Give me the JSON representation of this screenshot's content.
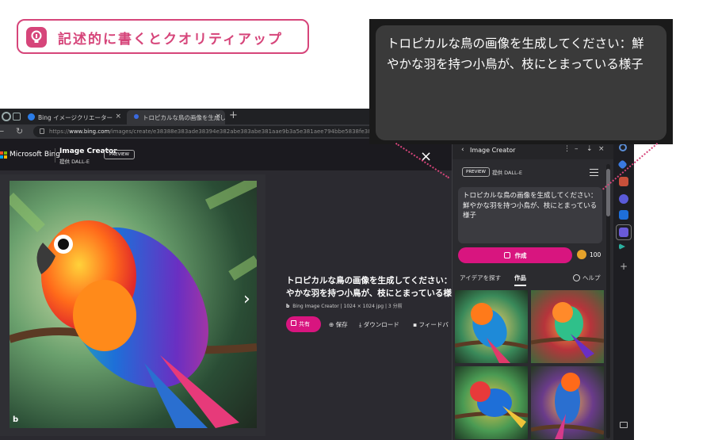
{
  "tip": {
    "text": "記述的に書くとクオリティアップ",
    "color": "#d6457a"
  },
  "callout": {
    "text": "トロピカルな鳥の画像を生成してください：鮮やかな羽を持つ小鳥が、枝にとまっている様子"
  },
  "browser": {
    "tabs": [
      {
        "label": "Bing イメージクリエーター",
        "close": "×"
      },
      {
        "label": "トロピカルな鳥の画像を生成してくださ",
        "close": "×"
      }
    ],
    "new_tab": "+",
    "url_prefix": "https://",
    "url_host": "www.bing.com",
    "url_path": "/images/create/e38388e383ade38394e382abe383abe381aae9b3a5e381aee794bbe5838fe38292e794"
  },
  "header": {
    "brand": "Microsoft Bing",
    "title": "Image Creator",
    "subtitle": "提供 DALL-E",
    "badge": "PREVIEW"
  },
  "detail": {
    "title_line1": "トロピカルな鳥の画像を生成してください：",
    "title_line2": "やかな羽を持つ小鳥が、枝にとまっている様",
    "meta_brand": "b",
    "meta": "Bing Image Creator | 1024 × 1024 jpg | 3 分前",
    "actions": {
      "share": "共有",
      "save": "保存",
      "download": "ダウンロード",
      "feedback": "フィードバ"
    },
    "close": "×",
    "next": "›",
    "watermark": "b"
  },
  "panel": {
    "back": "‹",
    "title": "Image Creator",
    "controls": [
      "⋮",
      "–",
      "⇣",
      "×"
    ],
    "badge": "PREVIEW",
    "provider": "提供 DALL-E",
    "prompt": "トロピカルな鳥の画像を生成してください：鮮やかな羽を持つ小鳥が、枝にとまっている様子",
    "create_label": "作成",
    "coins": "100",
    "tabs": {
      "ideas": "アイデアを探す",
      "works": "作品",
      "help": "ヘルプ"
    }
  },
  "edge": {
    "plus": "+"
  },
  "colors": {
    "accent": "#d8157f",
    "tip": "#d6457a",
    "bg_dark": "#1b1a1f",
    "panel": "#2b2b2f"
  }
}
